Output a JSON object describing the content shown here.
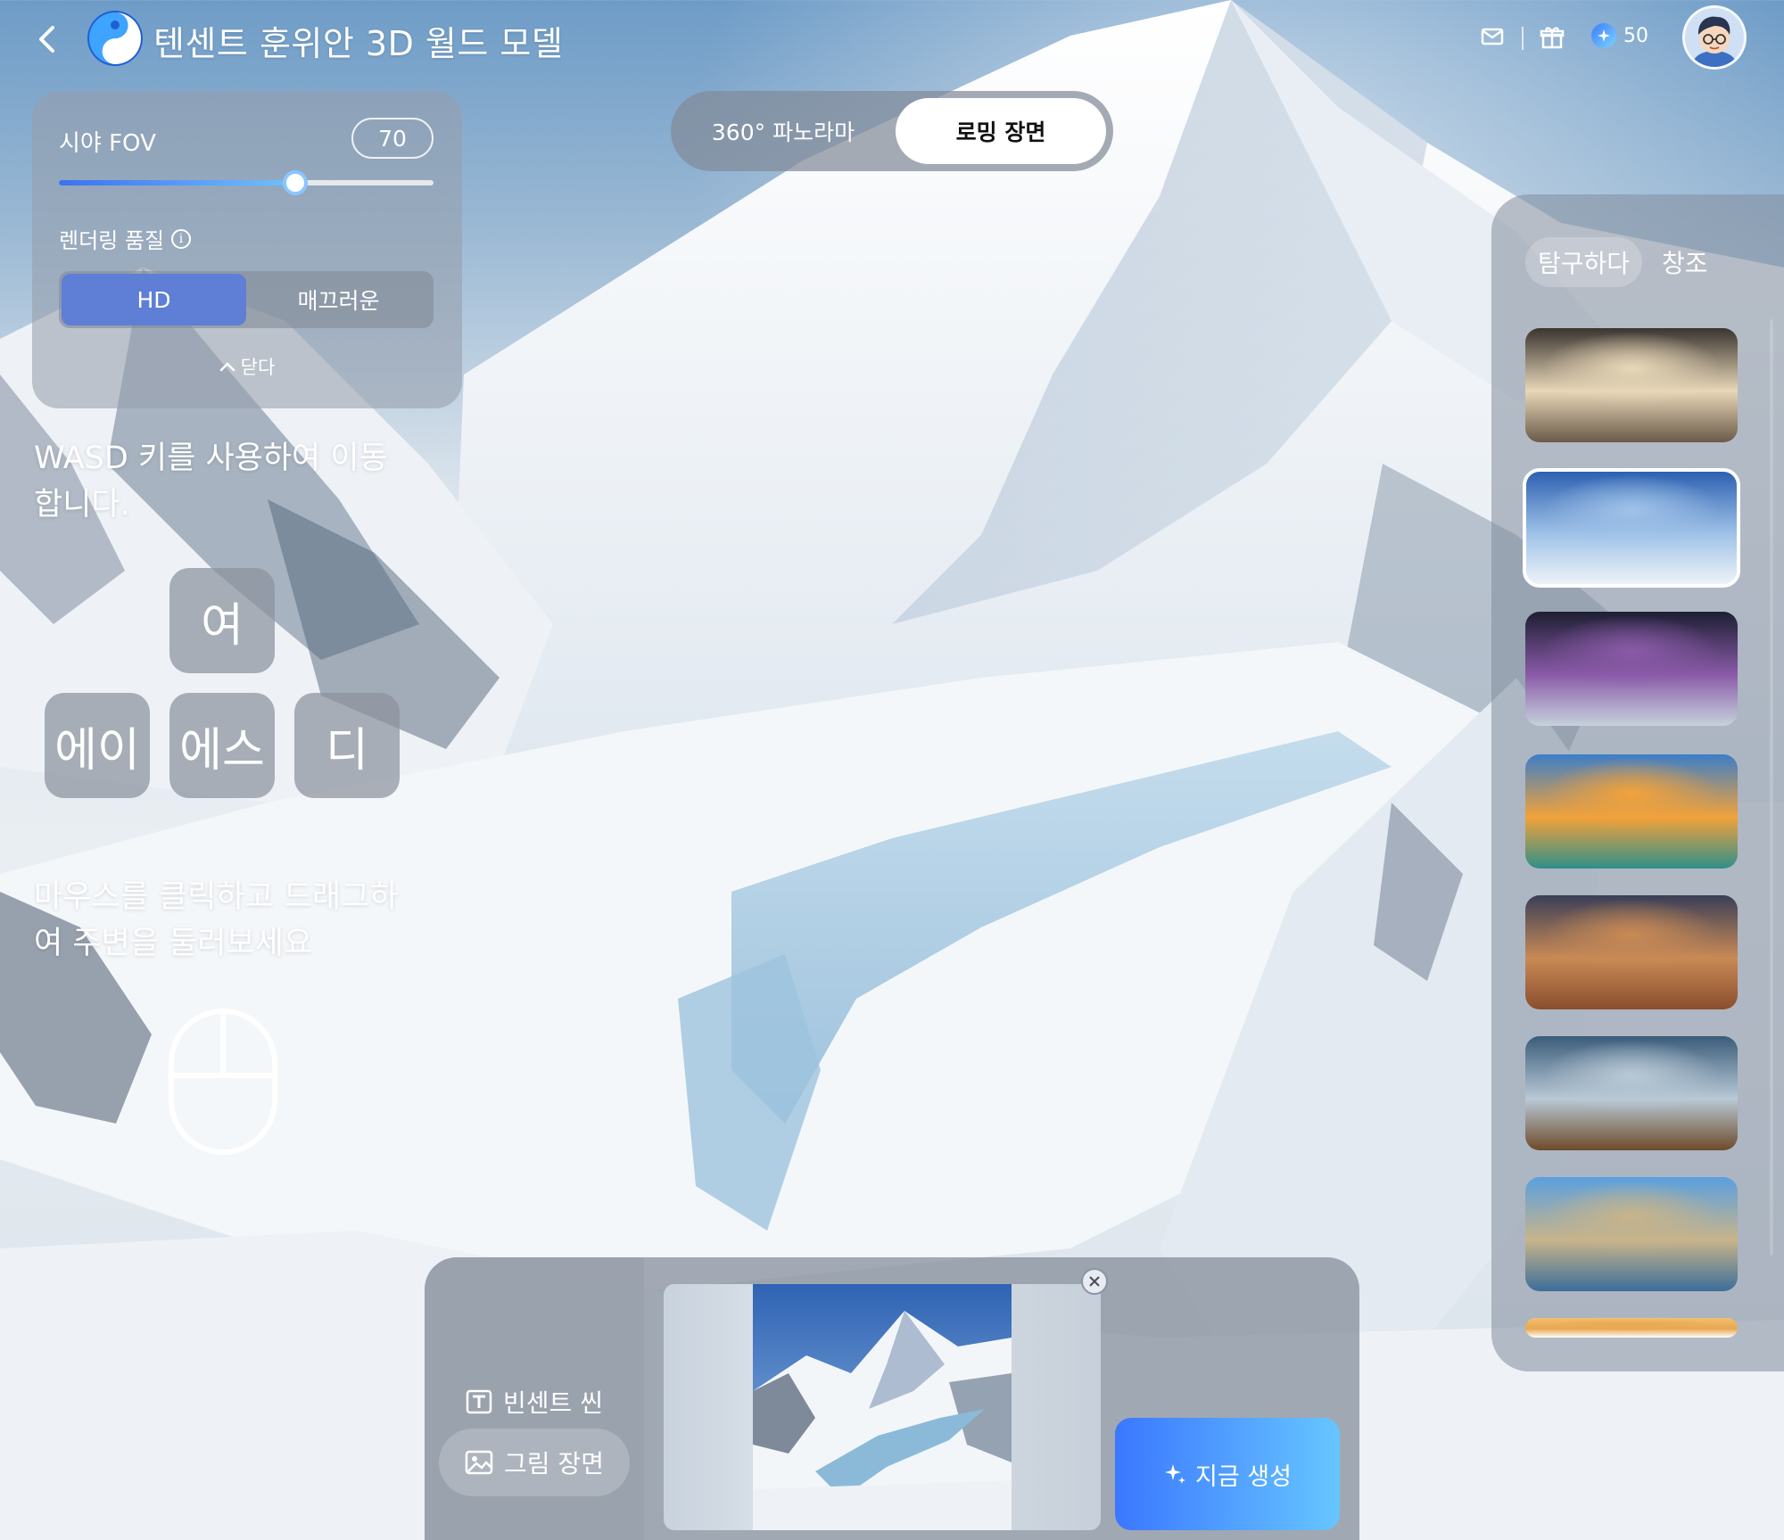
{
  "header": {
    "title": "텐센트 훈위안 3D 월드 모델",
    "credits": "50"
  },
  "settings": {
    "fov_label": "시야 FOV",
    "fov_value": "70",
    "fov_fraction": 0.63,
    "quality_label": "렌더링 품질",
    "quality_options": [
      "HD",
      "매끄러운"
    ],
    "quality_selected": "HD",
    "collapse_label": "닫다"
  },
  "instructions": {
    "wasd_text": "WASD 키를 사용하여 이동합니다.",
    "keys": [
      "여",
      "에이",
      "에스",
      "디"
    ],
    "mouse_text": "마우스를 클릭하고 드래그하여 주변을 둘러보세요"
  },
  "mode_toggle": {
    "options": [
      "360° 파노라마",
      "로밍 장면"
    ],
    "selected": "로밍 장면"
  },
  "gallery": {
    "tabs": [
      "탐구하다",
      "창조"
    ],
    "active_tab": "탐구하다",
    "thumbnails": [
      {
        "name": "fantasy-castle-thumbnail",
        "colors": [
          "#3b3530",
          "#e8d7b8",
          "#6a5a48"
        ]
      },
      {
        "name": "snow-mountain-thumbnail",
        "colors": [
          "#2b5fb0",
          "#9fc2e8",
          "#eef3f8"
        ],
        "selected": true
      },
      {
        "name": "aurora-night-thumbnail",
        "colors": [
          "#1d1f33",
          "#8a5aa8",
          "#c6d2dc"
        ]
      },
      {
        "name": "ocean-sunset-thumbnail",
        "colors": [
          "#3d7ec8",
          "#f2a23a",
          "#2f8f8a"
        ]
      },
      {
        "name": "desert-thumbnail",
        "colors": [
          "#3a3f58",
          "#c98a55",
          "#8a4e2e"
        ]
      },
      {
        "name": "waterfall-canyon-thumbnail",
        "colors": [
          "#3a5c7a",
          "#b9c9d6",
          "#6e4a2a"
        ]
      },
      {
        "name": "toy-village-thumbnail",
        "colors": [
          "#5aa0e0",
          "#c8b48a",
          "#3c6e9a"
        ]
      },
      {
        "name": "golden-thumbnail",
        "colors": [
          "#f0c070",
          "#e8a850",
          "#ffffff"
        ]
      }
    ]
  },
  "bottom": {
    "options": [
      "빈센트 씬",
      "그림 장면"
    ],
    "selected": "그림 장면",
    "generate_label": "지금 생성"
  }
}
